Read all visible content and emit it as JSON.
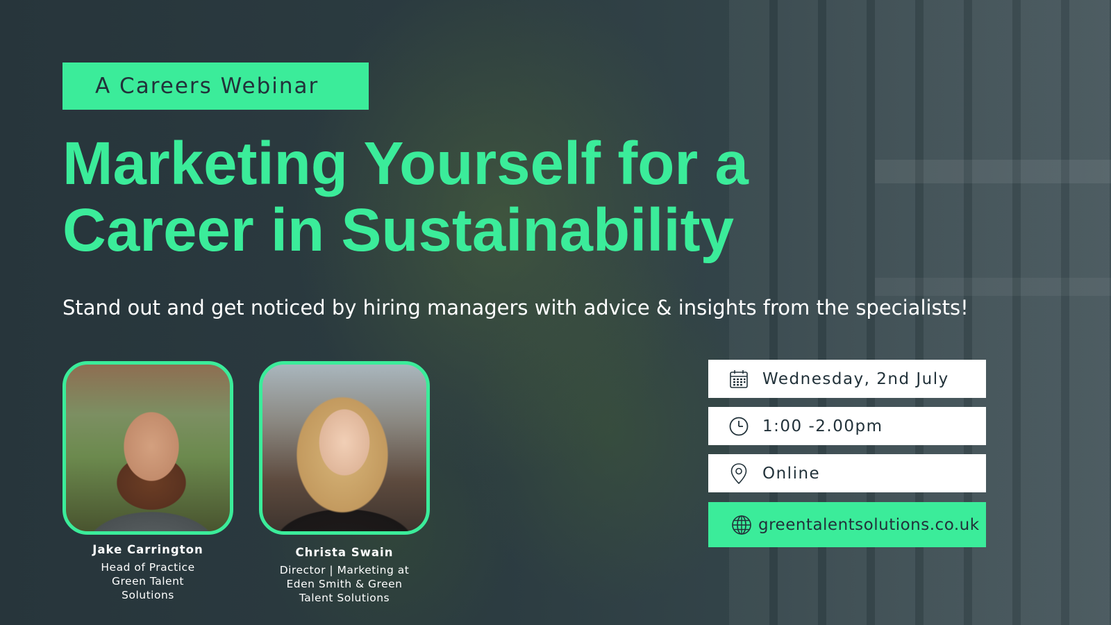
{
  "tag_label": "A Careers Webinar",
  "title": {
    "line1": "Marketing Yourself for a",
    "line2": "Career in Sustainability"
  },
  "subtitle": "Stand out and get noticed by hiring managers with advice & insights from the specialists!",
  "speakers": [
    {
      "name": "Jake Carrington",
      "role_lines": [
        "Head of Practice",
        "Green Talent",
        "Solutions"
      ]
    },
    {
      "name": "Christa Swain",
      "role_lines": [
        "Director | Marketing at",
        "Eden Smith & Green",
        "Talent Solutions"
      ]
    }
  ],
  "details": {
    "date": {
      "icon": "calendar-icon",
      "text": "Wednesday, 2nd July"
    },
    "time": {
      "icon": "clock-icon",
      "text": "1:00 -2.00pm"
    },
    "location": {
      "icon": "location-pin-icon",
      "text": "Online"
    },
    "website": {
      "icon": "globe-icon",
      "text": "greentalentsolutions.co.uk"
    }
  },
  "colors": {
    "accent": "#3bec9a",
    "dark": "#22323a",
    "background": "#2b3a40",
    "text_light": "#ffffff"
  }
}
